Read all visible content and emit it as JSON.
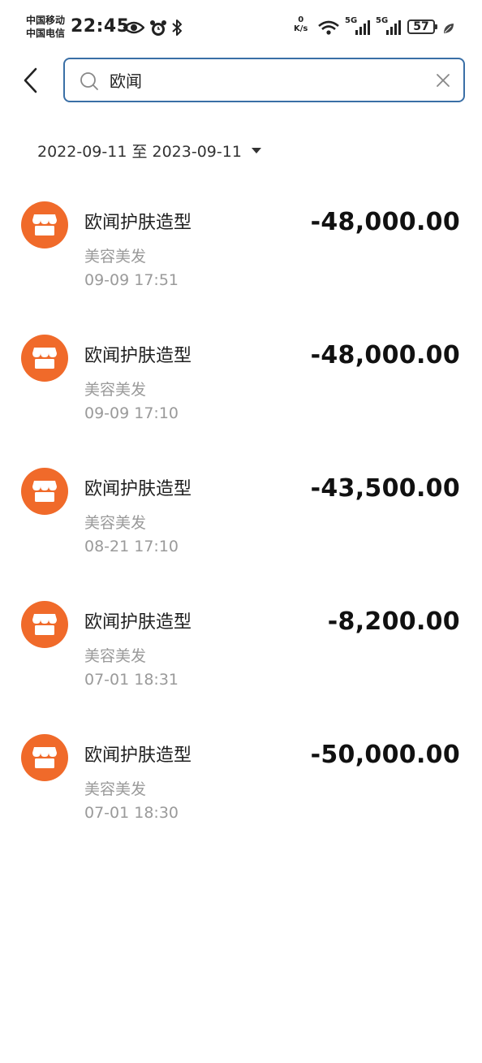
{
  "status_bar": {
    "carrier_1": "中国移动",
    "carrier_2": "中国电信",
    "time": "22:45",
    "net_speed_value": "0",
    "net_speed_unit": "K/s",
    "signal_1_label": "5G",
    "signal_2_label": "5G",
    "battery": "57",
    "icons": [
      "eye-icon",
      "alarm-icon",
      "bluetooth-icon",
      "wifi-icon",
      "signal-icon",
      "leaf-icon"
    ]
  },
  "search": {
    "query": "欧闻",
    "accent_color": "#3a6fa6"
  },
  "filter": {
    "date_range": "2022-09-11 至 2023-09-11"
  },
  "transactions": [
    {
      "merchant": "欧闻护肤造型",
      "category": "美容美发",
      "time": "09-09 17:51",
      "amount": "-48,000.00"
    },
    {
      "merchant": "欧闻护肤造型",
      "category": "美容美发",
      "time": "09-09 17:10",
      "amount": "-48,000.00"
    },
    {
      "merchant": "欧闻护肤造型",
      "category": "美容美发",
      "time": "08-21 17:10",
      "amount": "-43,500.00"
    },
    {
      "merchant": "欧闻护肤造型",
      "category": "美容美发",
      "time": "07-01 18:31",
      "amount": "-8,200.00"
    },
    {
      "merchant": "欧闻护肤造型",
      "category": "美容美发",
      "time": "07-01 18:30",
      "amount": "-50,000.00"
    }
  ],
  "colors": {
    "merchant_icon_bg": "#f06a2a",
    "secondary_text": "#9a9a9a"
  }
}
